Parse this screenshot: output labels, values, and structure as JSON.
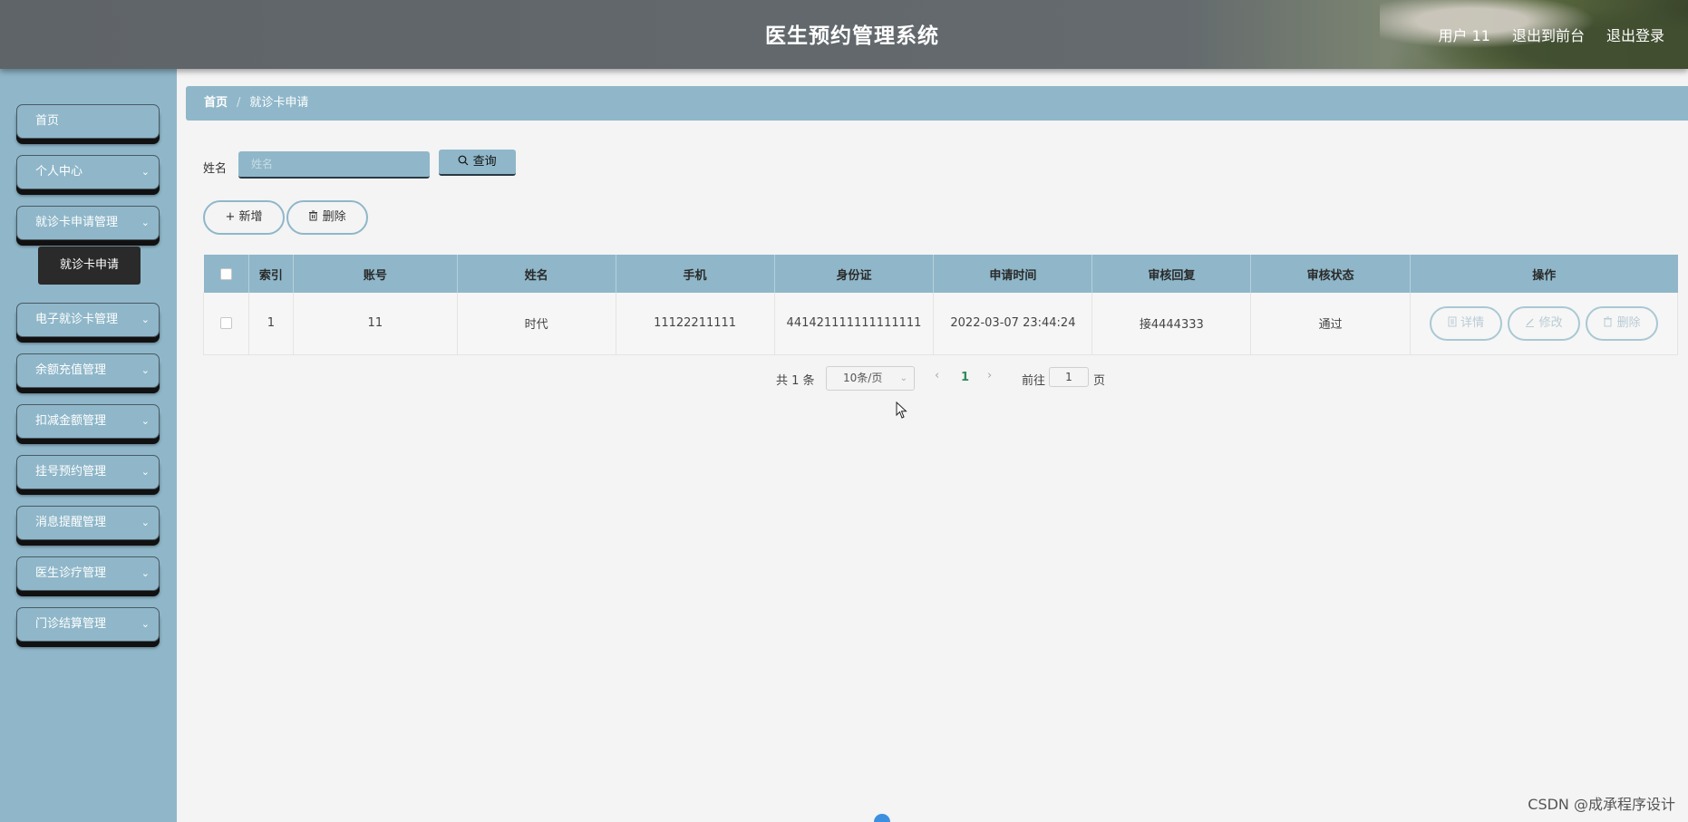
{
  "header": {
    "title": "医生预约管理系统",
    "user": "用户 11",
    "to_front": "退出到前台",
    "logout": "退出登录"
  },
  "sidebar": {
    "items": [
      {
        "label": "首页",
        "has_children": false
      },
      {
        "label": "个人中心",
        "has_children": true
      },
      {
        "label": "就诊卡申请管理",
        "has_children": true
      },
      {
        "label": "电子就诊卡管理",
        "has_children": true
      },
      {
        "label": "余额充值管理",
        "has_children": true
      },
      {
        "label": "扣减金额管理",
        "has_children": true
      },
      {
        "label": "挂号预约管理",
        "has_children": true
      },
      {
        "label": "消息提醒管理",
        "has_children": true
      },
      {
        "label": "医生诊疗管理",
        "has_children": true
      },
      {
        "label": "门诊结算管理",
        "has_children": true
      }
    ],
    "active_submenu": "就诊卡申请"
  },
  "breadcrumb": {
    "home": "首页",
    "separator": "/",
    "current": "就诊卡申请"
  },
  "search": {
    "label": "姓名",
    "placeholder": "姓名",
    "button": "查询"
  },
  "actions": {
    "add": "新增",
    "delete": "删除"
  },
  "table": {
    "columns": [
      "索引",
      "账号",
      "姓名",
      "手机",
      "身份证",
      "申请时间",
      "审核回复",
      "审核状态",
      "操作"
    ],
    "rows": [
      {
        "index": "1",
        "account": "11",
        "name": "时代",
        "phone": "11122211111",
        "id_card": "441421111111111111",
        "apply_time": "2022-03-07 23:44:24",
        "reply": "接4444333",
        "status": "通过"
      }
    ],
    "row_actions": {
      "detail": "详情",
      "edit": "修改",
      "delete": "删除"
    }
  },
  "pagination": {
    "total": "共 1 条",
    "page_size": "10条/页",
    "current_page": "1",
    "goto_label": "前往",
    "goto_value": "1",
    "page_label": "页"
  },
  "watermark": "CSDN @成承程序设计"
}
